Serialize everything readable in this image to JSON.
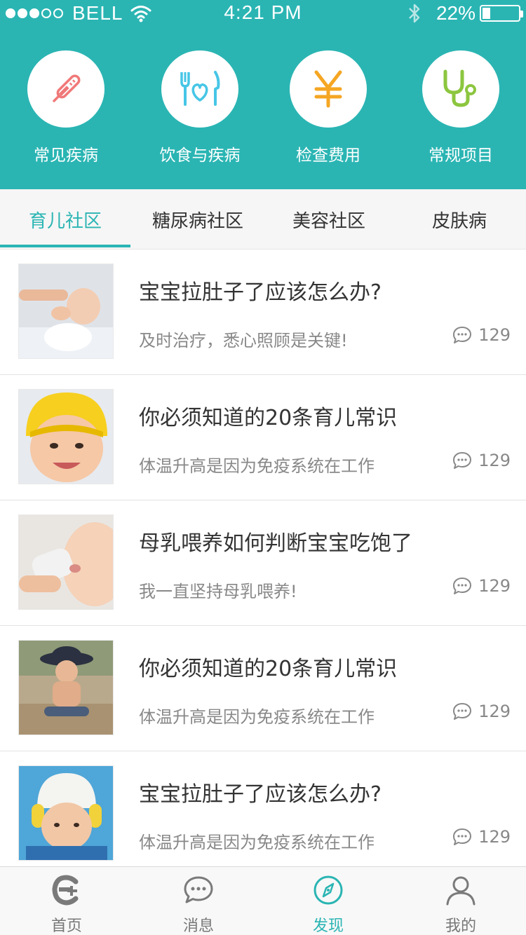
{
  "status": {
    "carrier": "BELL",
    "time": "4:21 PM",
    "battery": "22%",
    "battery_level": 0.22,
    "signal_bars": 3
  },
  "quicknav": [
    {
      "label": "常见疾病",
      "icon": "thermometer-icon",
      "color": "#f07878"
    },
    {
      "label": "饮食与疾病",
      "icon": "heart-fork-knife-icon",
      "color": "#46c6e6"
    },
    {
      "label": "检查费用",
      "icon": "yen-icon",
      "color": "#f5a623"
    },
    {
      "label": "常规项目",
      "icon": "stethoscope-icon",
      "color": "#8cc63f"
    }
  ],
  "tabs": [
    {
      "label": "育儿社区",
      "active": true
    },
    {
      "label": "糖尿病社区",
      "active": false
    },
    {
      "label": "美容社区",
      "active": false
    },
    {
      "label": "皮肤病",
      "active": false
    }
  ],
  "posts": [
    {
      "title": "宝宝拉肚子了应该怎么办?",
      "subtitle": "及时治疗，悉心照顾是关键!",
      "comments": "129"
    },
    {
      "title": "你必须知道的20条育儿常识",
      "subtitle": "体温升高是因为免疫系统在工作",
      "comments": "129"
    },
    {
      "title": "母乳喂养如何判断宝宝吃饱了",
      "subtitle": "我一直坚持母乳喂养!",
      "comments": "129"
    },
    {
      "title": "你必须知道的20条育儿常识",
      "subtitle": "体温升高是因为免疫系统在工作",
      "comments": "129"
    },
    {
      "title": "宝宝拉肚子了应该怎么办?",
      "subtitle": "体温升高是因为免疫系统在工作",
      "comments": "129"
    }
  ],
  "tabbar": [
    {
      "label": "首页",
      "icon": "home-e-icon",
      "active": false
    },
    {
      "label": "消息",
      "icon": "chat-bubble-icon",
      "active": false
    },
    {
      "label": "发现",
      "icon": "compass-icon",
      "active": true
    },
    {
      "label": "我的",
      "icon": "person-icon",
      "active": false
    }
  ],
  "colors": {
    "accent": "#2ab5b3",
    "text": "#333333",
    "muted": "#888888"
  }
}
